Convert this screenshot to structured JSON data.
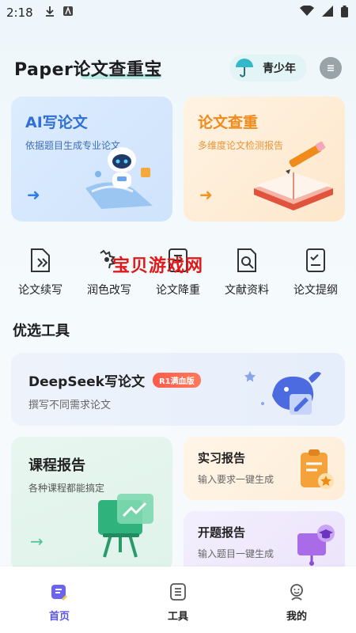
{
  "status_bar": {
    "time": "2:18"
  },
  "header": {
    "title": "Paper论文查重宝",
    "mode_label": "青少年"
  },
  "feature_cards": [
    {
      "title": "AI写论文",
      "subtitle": "依据题目生成专业论文",
      "arrow": "➜"
    },
    {
      "title": "论文查重",
      "subtitle": "多维度论文检测报告",
      "arrow": "➜"
    }
  ],
  "quick_tools": [
    {
      "label": "论文续写"
    },
    {
      "label": "润色改写"
    },
    {
      "label": "论文降重"
    },
    {
      "label": "文献资料"
    },
    {
      "label": "论文提纲"
    }
  ],
  "watermark": "宝贝游戏网",
  "section_title": "优选工具",
  "deepseek_card": {
    "title": "DeepSeek写论文",
    "badge": "R1满血版",
    "subtitle": "撰写不同需求论文"
  },
  "course_card": {
    "title": "课程报告",
    "subtitle": "各种课程都能搞定",
    "arrow": "→"
  },
  "intern_card": {
    "title": "实习报告",
    "subtitle": "输入要求一键生成"
  },
  "proposal_card": {
    "title": "开题报告",
    "subtitle": "输入题目一键生成"
  },
  "tab_bar": {
    "tabs": [
      {
        "label": "首页",
        "active": true
      },
      {
        "label": "工具",
        "active": false
      },
      {
        "label": "我的",
        "active": false
      }
    ]
  },
  "colors": {
    "accent": "#5b55e6",
    "ai_blue": "#2f6fd6",
    "check_orange": "#f08a1b",
    "badge_red": "#ff5a4a"
  }
}
